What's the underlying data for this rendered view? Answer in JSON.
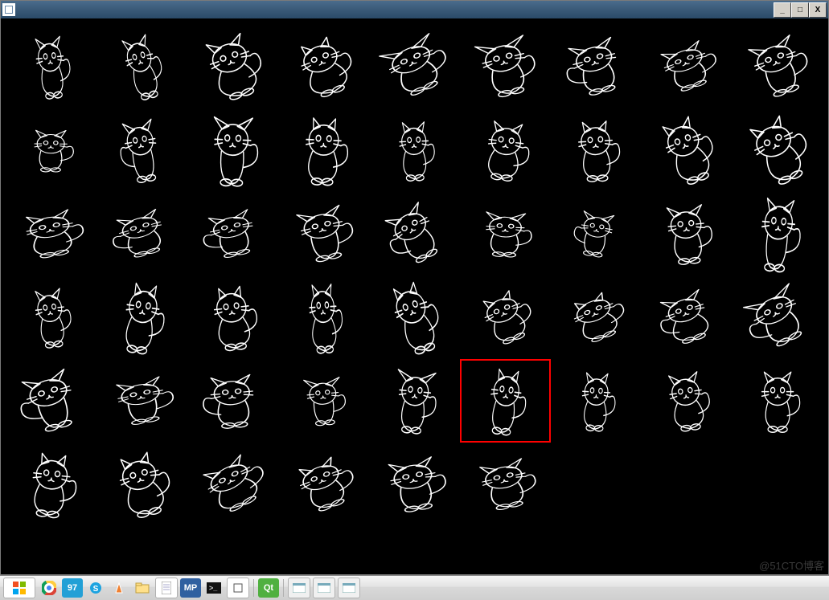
{
  "window": {
    "title": "",
    "minimize_label": "_",
    "maximize_label": "□",
    "close_label": "X"
  },
  "grid": {
    "columns": 9,
    "rows_visible": 6,
    "last_row_count": 6,
    "highlighted_index": 41,
    "cells": [
      {
        "name": "cat-01"
      },
      {
        "name": "cat-02"
      },
      {
        "name": "cat-03"
      },
      {
        "name": "cat-04"
      },
      {
        "name": "cat-05"
      },
      {
        "name": "cat-06"
      },
      {
        "name": "cat-07"
      },
      {
        "name": "cat-08"
      },
      {
        "name": "cat-09"
      },
      {
        "name": "cat-10"
      },
      {
        "name": "cat-11"
      },
      {
        "name": "cat-12"
      },
      {
        "name": "cat-13"
      },
      {
        "name": "cat-14"
      },
      {
        "name": "cat-15"
      },
      {
        "name": "cat-16"
      },
      {
        "name": "cat-17"
      },
      {
        "name": "cat-18"
      },
      {
        "name": "cat-19"
      },
      {
        "name": "cat-20"
      },
      {
        "name": "cat-21"
      },
      {
        "name": "cat-22"
      },
      {
        "name": "cat-23"
      },
      {
        "name": "cat-24"
      },
      {
        "name": "cat-25"
      },
      {
        "name": "cat-26"
      },
      {
        "name": "cat-27"
      },
      {
        "name": "cat-28"
      },
      {
        "name": "cat-29"
      },
      {
        "name": "cat-30"
      },
      {
        "name": "cat-31"
      },
      {
        "name": "cat-32"
      },
      {
        "name": "cat-33"
      },
      {
        "name": "cat-34"
      },
      {
        "name": "cat-35"
      },
      {
        "name": "cat-36"
      },
      {
        "name": "cat-37"
      },
      {
        "name": "cat-38"
      },
      {
        "name": "cat-39"
      },
      {
        "name": "cat-40"
      },
      {
        "name": "cat-41"
      },
      {
        "name": "cat-42"
      },
      {
        "name": "cat-43"
      },
      {
        "name": "cat-44"
      },
      {
        "name": "cat-45"
      },
      {
        "name": "cat-46"
      },
      {
        "name": "cat-47"
      },
      {
        "name": "cat-48"
      },
      {
        "name": "cat-49"
      },
      {
        "name": "cat-50"
      },
      {
        "name": "cat-51"
      }
    ]
  },
  "watermark": "@51CTO博客",
  "taskbar": {
    "items": [
      {
        "name": "start",
        "label": ""
      },
      {
        "name": "chrome",
        "label": "",
        "color": "#f4c542"
      },
      {
        "name": "app-97",
        "label": "97",
        "color": "#22a0d6"
      },
      {
        "name": "skype",
        "label": "",
        "color": "#1ca3e0"
      },
      {
        "name": "vlc",
        "label": "",
        "color": "#f08030"
      },
      {
        "name": "explorer",
        "label": "",
        "color": "#f0d070"
      },
      {
        "name": "notepad",
        "label": "",
        "color": "#e0e0e0"
      },
      {
        "name": "mp",
        "label": "MP",
        "color": "#3060a0"
      },
      {
        "name": "cmd",
        "label": "",
        "color": "#202020"
      },
      {
        "name": "devtool",
        "label": "",
        "color": "#ffffff"
      },
      {
        "name": "qt",
        "label": "Qt",
        "color": "#50b040"
      },
      {
        "name": "window-a",
        "label": "",
        "color": "#f0f0f0"
      },
      {
        "name": "window-b",
        "label": "",
        "color": "#f0f0f0"
      },
      {
        "name": "window-c",
        "label": "",
        "color": "#f0f0f0"
      }
    ]
  }
}
